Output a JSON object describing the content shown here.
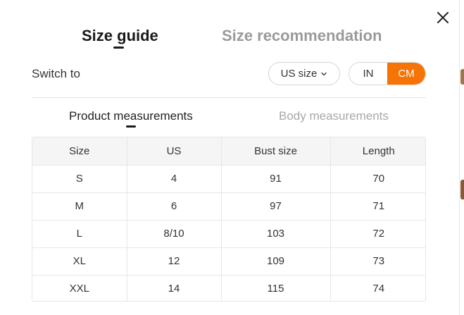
{
  "dialog": {
    "tabs": [
      {
        "label": "Size guide",
        "active": true
      },
      {
        "label": "Size recommendation",
        "active": false
      }
    ],
    "close_icon": "close-icon"
  },
  "switch": {
    "label": "Switch to",
    "size_system": "US size",
    "units": [
      {
        "label": "IN",
        "active": false
      },
      {
        "label": "CM",
        "active": true
      }
    ]
  },
  "measure_tabs": [
    {
      "label": "Product measurements",
      "active": true
    },
    {
      "label": "Body measurements",
      "active": false
    }
  ],
  "table": {
    "headers": [
      "Size",
      "US",
      "Bust size",
      "Length"
    ],
    "rows": [
      [
        "S",
        "4",
        "91",
        "70"
      ],
      [
        "M",
        "6",
        "97",
        "71"
      ],
      [
        "L",
        "8/10",
        "103",
        "72"
      ],
      [
        "XL",
        "12",
        "109",
        "73"
      ],
      [
        "XXL",
        "14",
        "115",
        "74"
      ]
    ]
  },
  "colors": {
    "accent": "#f67306",
    "active_text": "#1a1a1a",
    "inactive_text": "#9a9a9a",
    "header_bg": "#f5f5f5"
  }
}
